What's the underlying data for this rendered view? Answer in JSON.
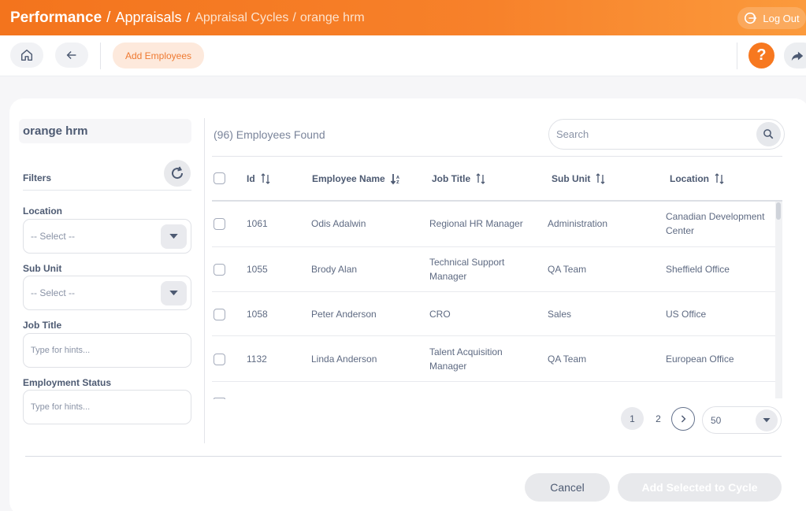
{
  "header": {
    "breadcrumb": [
      "Performance",
      "Appraisals",
      "Appraisal Cycles",
      "orange hrm"
    ],
    "logout_label": "Log Out"
  },
  "toolbar": {
    "home_icon": "home-icon",
    "back_icon": "arrow-left-icon",
    "add_employees_label": "Add Employees",
    "help_label": "?",
    "share_icon": "share-icon"
  },
  "sidebar": {
    "cycle_name": "orange hrm",
    "filters_label": "Filters",
    "location": {
      "label": "Location",
      "value": "-- Select --"
    },
    "sub_unit": {
      "label": "Sub Unit",
      "value": "-- Select --"
    },
    "job_title": {
      "label": "Job Title",
      "placeholder": "Type for hints..."
    },
    "employment_status": {
      "label": "Employment Status",
      "placeholder": "Type for hints..."
    }
  },
  "main": {
    "found_text": "(96) Employees Found",
    "search_placeholder": "Search",
    "columns": [
      "Id",
      "Employee Name",
      "Job Title",
      "Sub Unit",
      "Location"
    ],
    "rows": [
      {
        "id": "1061",
        "name": "Odis Adalwin",
        "job_title": [
          "Regional HR Manager"
        ],
        "sub_unit": "Administration",
        "location": [
          "Canadian Development",
          "Center"
        ]
      },
      {
        "id": "1055",
        "name": "Brody Alan",
        "job_title": [
          "Technical Support",
          "Manager"
        ],
        "sub_unit": "QA Team",
        "location": [
          "Sheffield Office"
        ]
      },
      {
        "id": "1058",
        "name": "Peter Anderson",
        "job_title": [
          "CRO"
        ],
        "sub_unit": "Sales",
        "location": [
          "US Office"
        ]
      },
      {
        "id": "1132",
        "name": "Linda Anderson",
        "job_title": [
          "Talent Acquisition",
          "Manager"
        ],
        "sub_unit": "QA Team",
        "location": [
          "European Office"
        ]
      }
    ],
    "pagination": {
      "pages": [
        "1",
        "2"
      ],
      "current": "1",
      "per_page": "50"
    }
  },
  "footer": {
    "cancel_label": "Cancel",
    "add_selected_label": "Add Selected to Cycle"
  },
  "colors": {
    "accent": "#f7781f",
    "header_start": "#f3741d",
    "header_end": "#fb9a3c"
  }
}
